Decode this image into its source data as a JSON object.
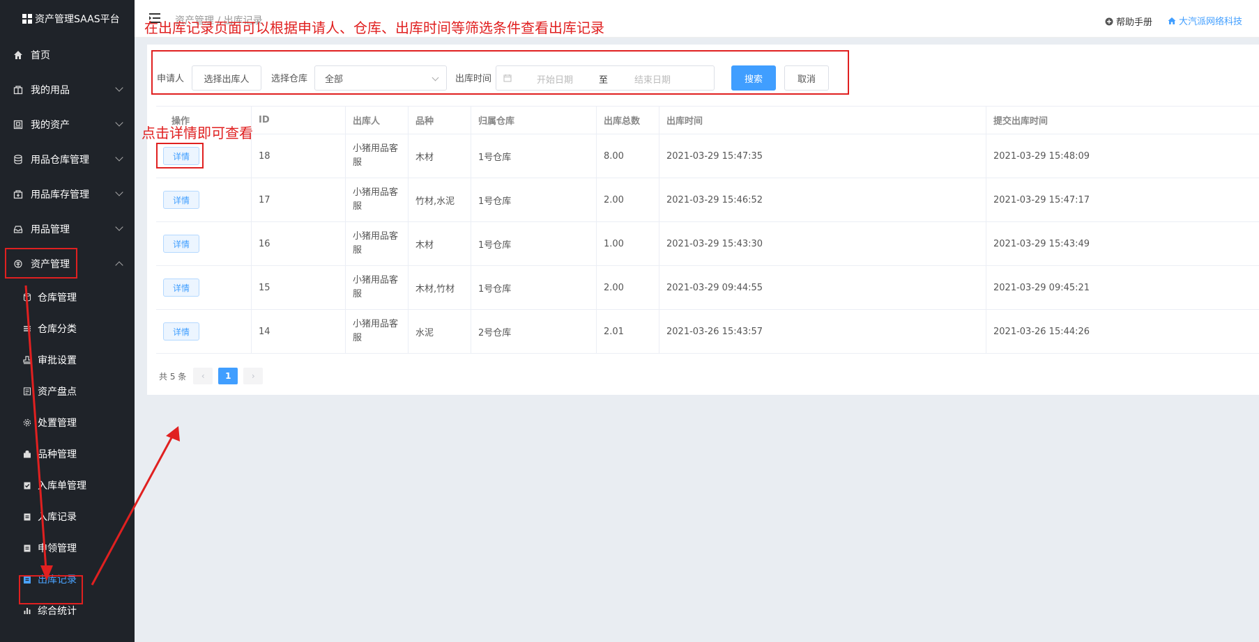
{
  "brand": {
    "title": "资产管理SAAS平台"
  },
  "sidebar": {
    "items": [
      {
        "label": "首页",
        "icon": "home-icon"
      },
      {
        "label": "我的用品",
        "icon": "box-icon"
      },
      {
        "label": "我的资产",
        "icon": "asset-icon"
      },
      {
        "label": "用品仓库管理",
        "icon": "database-icon"
      },
      {
        "label": "用品库存管理",
        "icon": "inventory-icon"
      },
      {
        "label": "用品管理",
        "icon": "tray-icon"
      },
      {
        "label": "资产管理",
        "icon": "asset-manage-icon"
      }
    ],
    "subitems": [
      {
        "label": "仓库管理",
        "icon": "database-icon"
      },
      {
        "label": "仓库分类",
        "icon": "list-icon"
      },
      {
        "label": "审批设置",
        "icon": "stamp-icon"
      },
      {
        "label": "资产盘点",
        "icon": "doc-icon"
      },
      {
        "label": "处置管理",
        "icon": "gear-icon"
      },
      {
        "label": "品种管理",
        "icon": "bag-icon"
      },
      {
        "label": "入库单管理",
        "icon": "clipboard-check-icon"
      },
      {
        "label": "入库记录",
        "icon": "clipboard-icon"
      },
      {
        "label": "申领管理",
        "icon": "clipboard-icon"
      },
      {
        "label": "出库记录",
        "icon": "clipboard-icon"
      },
      {
        "label": "综合统计",
        "icon": "bar-chart-icon"
      }
    ]
  },
  "header": {
    "breadcrumb": "资产管理 / 出库记录",
    "help": "帮助手册",
    "company": "大汽派网络科技"
  },
  "annotations": {
    "top": "在出库记录页面可以根据申请人、仓库、出库时间等筛选条件查看出库记录",
    "detail": "点击详情即可查看"
  },
  "filter": {
    "applicant_label": "申请人",
    "applicant_button": "选择出库人",
    "warehouse_label": "选择仓库",
    "warehouse_value": "全部",
    "time_label": "出库时间",
    "start_placeholder": "开始日期",
    "separator": "至",
    "end_placeholder": "结束日期",
    "search": "搜索",
    "cancel": "取消"
  },
  "table": {
    "headers": [
      "操作",
      "ID",
      "出库人",
      "品种",
      "归属仓库",
      "出库总数",
      "出库时间",
      "提交出库时间"
    ],
    "detail_label": "详情",
    "rows": [
      {
        "id": "18",
        "person": "小猪用品客服",
        "variety": "木材",
        "warehouse": "1号仓库",
        "total": "8.00",
        "out_time": "2021-03-29 15:47:35",
        "submit_time": "2021-03-29 15:48:09"
      },
      {
        "id": "17",
        "person": "小猪用品客服",
        "variety": "竹材,水泥",
        "warehouse": "1号仓库",
        "total": "2.00",
        "out_time": "2021-03-29 15:46:52",
        "submit_time": "2021-03-29 15:47:17"
      },
      {
        "id": "16",
        "person": "小猪用品客服",
        "variety": "木材",
        "warehouse": "1号仓库",
        "total": "1.00",
        "out_time": "2021-03-29 15:43:30",
        "submit_time": "2021-03-29 15:43:49"
      },
      {
        "id": "15",
        "person": "小猪用品客服",
        "variety": "木材,竹材",
        "warehouse": "1号仓库",
        "total": "2.00",
        "out_time": "2021-03-29 09:44:55",
        "submit_time": "2021-03-29 09:45:21"
      },
      {
        "id": "14",
        "person": "小猪用品客服",
        "variety": "水泥",
        "warehouse": "2号仓库",
        "total": "2.01",
        "out_time": "2021-03-26 15:43:57",
        "submit_time": "2021-03-26 15:44:26"
      }
    ]
  },
  "pagination": {
    "total": "共 5 条",
    "current": "1"
  },
  "colors": {
    "primary": "#409eff",
    "annotation": "#e02020",
    "sidebar_bg": "#1f2329"
  }
}
